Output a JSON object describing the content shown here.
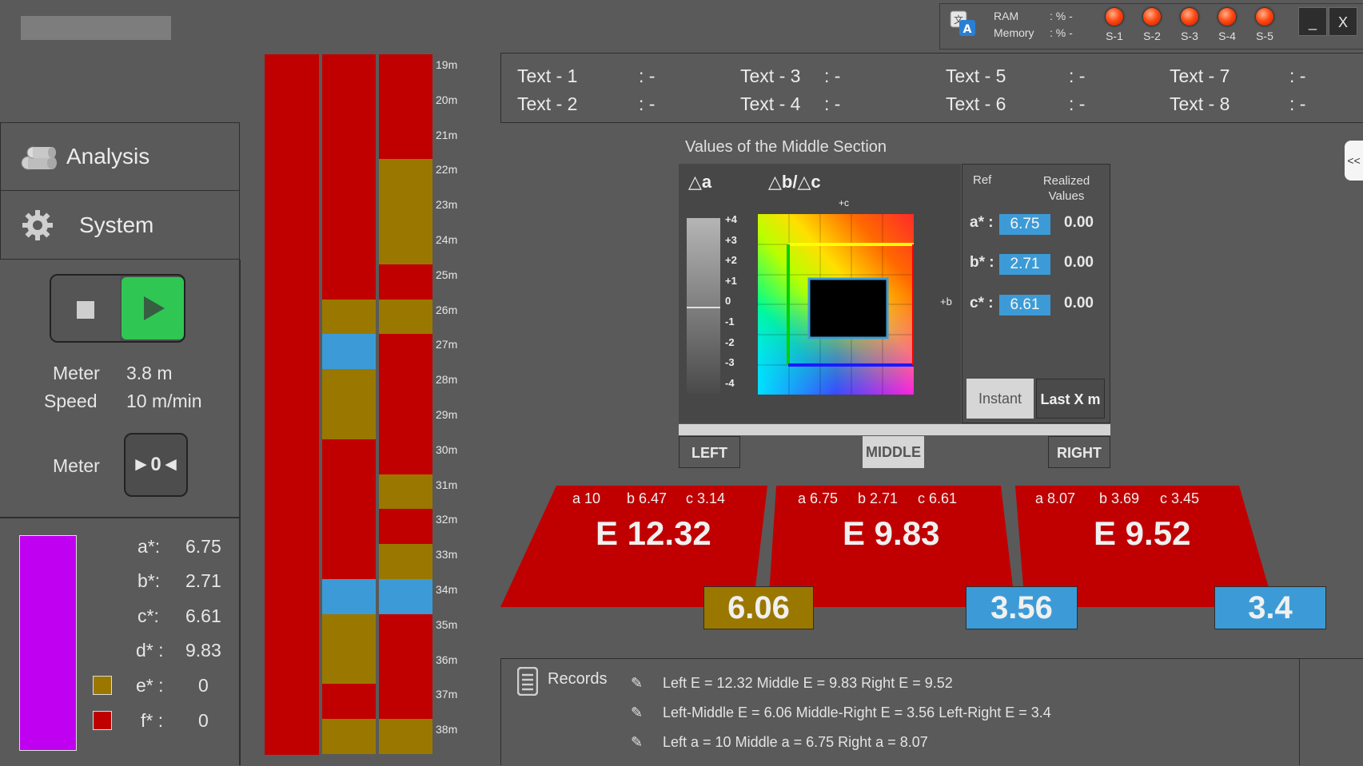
{
  "status": {
    "ram_label": "RAM",
    "ram_value": ": % -",
    "memory_label": "Memory",
    "memory_value": ": % -",
    "leds": [
      "S-1",
      "S-2",
      "S-3",
      "S-4",
      "S-5"
    ],
    "minimize": "_",
    "close": "X"
  },
  "nav": {
    "analysis": "Analysis",
    "system": "System"
  },
  "meter": {
    "meter_label": "Meter",
    "meter_value": "3.8 m",
    "speed_label": "Speed",
    "speed_value": "10 m/min",
    "reset_label": "Meter",
    "reset_button": "►0◄"
  },
  "values": {
    "a_label": "a*:",
    "a": "6.75",
    "b_label": "b*:",
    "b": "2.71",
    "c_label": "c*:",
    "c": "6.61",
    "d_label": "d* :",
    "d": "9.83",
    "e_label": "e* :",
    "e": "0",
    "f_label": "f* :",
    "f": "0",
    "swatch_color": "#c000f0",
    "e_color": "#9a7800",
    "f_color": "#c00000"
  },
  "strips": {
    "colors": {
      "red": "#c00000",
      "olive": "#9a7800",
      "blue": "#3c9bd6"
    },
    "ticks": [
      "19m",
      "20m",
      "21m",
      "22m",
      "23m",
      "24m",
      "25m",
      "26m",
      "27m",
      "28m",
      "29m",
      "30m",
      "31m",
      "32m",
      "33m",
      "34m",
      "35m",
      "36m",
      "37m",
      "38m"
    ]
  },
  "texts": [
    {
      "label": "Text - 1",
      "value": ": -"
    },
    {
      "label": "Text - 2",
      "value": ": -"
    },
    {
      "label": "Text - 3",
      "value": ": -"
    },
    {
      "label": "Text - 4",
      "value": ": -"
    },
    {
      "label": "Text - 5",
      "value": ": -"
    },
    {
      "label": "Text - 6",
      "value": ": -"
    },
    {
      "label": "Text - 7",
      "value": ": -"
    },
    {
      "label": "Text - 8",
      "value": ": -"
    }
  ],
  "middle": {
    "title": "Values of the Middle Section",
    "delta_a": "△a",
    "delta_bc": "△b/△c",
    "scale": [
      "+4",
      "+3",
      "+2",
      "+1",
      "0",
      "-1",
      "-2",
      "-3",
      "-4"
    ],
    "plus_c": "+c",
    "plus_b": "+b",
    "ref_label": "Ref",
    "realized_label": "Realized Values",
    "rows": [
      {
        "label": "a* :",
        "ref": "6.75",
        "realized": "0.00"
      },
      {
        "label": "b* :",
        "ref": "2.71",
        "realized": "0.00"
      },
      {
        "label": "c* :",
        "ref": "6.61",
        "realized": "0.00"
      }
    ],
    "instant": "Instant",
    "last_x": "Last X m"
  },
  "positions": {
    "left": "LEFT",
    "middle": "MIDDLE",
    "right": "RIGHT"
  },
  "sections": [
    {
      "a": "a 10",
      "b": "b 6.47",
      "c": "c 3.14",
      "e": "E 12.32"
    },
    {
      "a": "a 6.75",
      "b": "b 2.71",
      "c": "c 6.61",
      "e": "E 9.83"
    },
    {
      "a": "a 8.07",
      "b": "b 3.69",
      "c": "c 3.45",
      "e": "E 9.52"
    }
  ],
  "diffs": [
    "6.06",
    "3.56",
    "3.4"
  ],
  "records": {
    "title": "Records",
    "lines": [
      "Left E = 12.32 Middle E = 9.83 Right E = 9.52",
      "Left-Middle E = 6.06 Middle-Right E = 3.56 Left-Right E = 3.4",
      "Left a = 10 Middle a = 6.75 Right a = 8.07"
    ]
  },
  "side_tab": "<<"
}
